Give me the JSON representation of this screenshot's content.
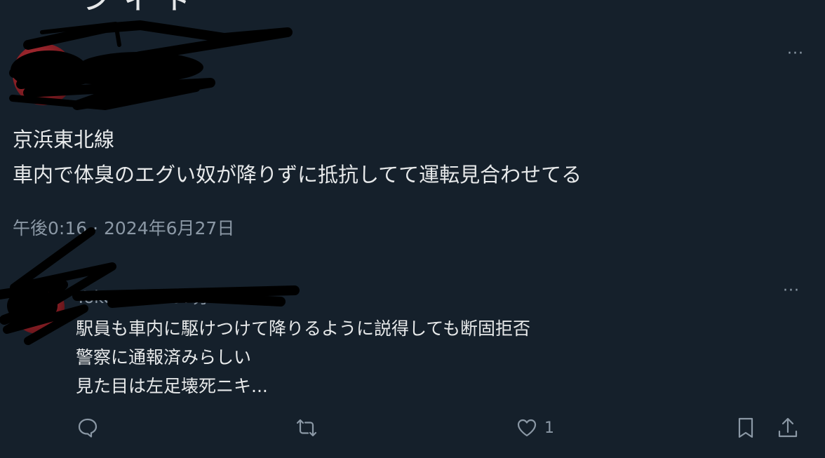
{
  "top_cut_text": "ン イ ト",
  "main_tweet": {
    "author_name": "",
    "author_handle": "",
    "text_lines": [
      "京浜東北線",
      "車内で体臭のエグい奴が降りずに抵抗してて運転見合わせてる"
    ],
    "timestamp": "午後0:16 · 2024年6月27日",
    "more_label": "···"
  },
  "reply_tweet": {
    "author_name": "",
    "author_handle": "Yoke_SAS",
    "time_suffix": " · 37分",
    "text_lines": [
      "駅員も車内に駆けつけて降りるように説得しても断固拒否",
      "警察に通報済みらしい",
      "見た目は左足壊死ニキ..."
    ],
    "more_label": "···"
  },
  "actions": {
    "like_count": "1"
  },
  "icons": {
    "reply": "reply-icon",
    "retweet": "retweet-icon",
    "like": "heart-icon",
    "bookmark": "bookmark-icon",
    "share": "share-icon"
  },
  "colors": {
    "background": "#15202b",
    "text_primary": "#e7e9ea",
    "text_secondary": "#8b98a5",
    "redaction": "#000000",
    "avatar_red": "#c4343c"
  }
}
